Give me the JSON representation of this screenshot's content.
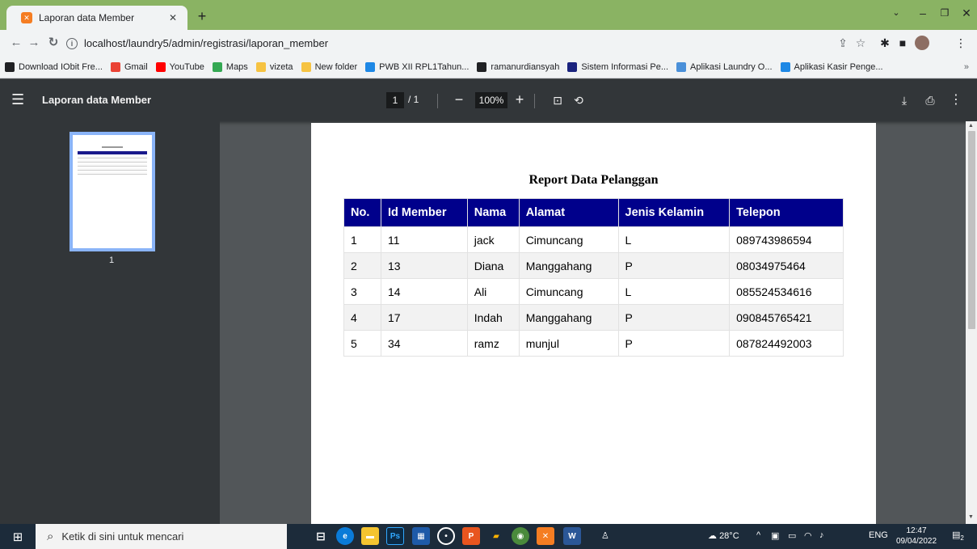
{
  "browser": {
    "tab_title": "Laporan data Member",
    "tab_favicon": "XAMPP",
    "url": "localhost/laundry5/admin/registrasi/laporan_member",
    "bookmarks": [
      {
        "label": "Download IObit Fre...",
        "icon": "download-icon",
        "color": "#202124"
      },
      {
        "label": "Gmail",
        "icon": "gmail-icon",
        "color": "#ea4335"
      },
      {
        "label": "YouTube",
        "icon": "youtube-icon",
        "color": "#ff0000"
      },
      {
        "label": "Maps",
        "icon": "maps-icon",
        "color": "#34a853"
      },
      {
        "label": "vizeta",
        "icon": "folder-icon",
        "color": "#f6c342"
      },
      {
        "label": "New folder",
        "icon": "folder-icon",
        "color": "#f6c342"
      },
      {
        "label": "PWB XII RPL1Tahun...",
        "icon": "classroom-icon",
        "color": "#1e88e5"
      },
      {
        "label": "ramanurdiansyah",
        "icon": "github-icon",
        "color": "#202124"
      },
      {
        "label": "Sistem Informasi Pe...",
        "icon": "d-app-icon",
        "color": "#1a237e"
      },
      {
        "label": "Aplikasi Laundry O...",
        "icon": "laundry-app-icon",
        "color": "#4a90d9"
      },
      {
        "label": "Aplikasi Kasir Penge...",
        "icon": "kasir-app-icon",
        "color": "#1e88e5"
      }
    ],
    "bookmarks_more": "»"
  },
  "pdf_viewer": {
    "title": "Laporan data Member",
    "current_page": "1",
    "total_pages": "/ 1",
    "zoom": "100%",
    "thumbnail_label": "1"
  },
  "report": {
    "title": "Report Data Pelanggan",
    "columns": [
      "No.",
      "Id Member",
      "Nama",
      "Alamat",
      "Jenis Kelamin",
      "Telepon"
    ],
    "rows": [
      [
        "1",
        "11",
        "jack",
        "Cimuncang",
        "L",
        "089743986594"
      ],
      [
        "2",
        "13",
        "Diana",
        "Manggahang",
        "P",
        "08034975464"
      ],
      [
        "3",
        "14",
        "Ali",
        "Cimuncang",
        "L",
        "085524534616"
      ],
      [
        "4",
        "17",
        "Indah",
        "Manggahang",
        "P",
        "090845765421"
      ],
      [
        "5",
        "34",
        "ramz",
        "munjul",
        "P",
        "087824492003"
      ]
    ]
  },
  "taskbar": {
    "search_placeholder": "Ketik di sini untuk mencari",
    "weather": "28°C",
    "language": "ENG",
    "time": "12:47",
    "date": "09/04/2022",
    "notification_count": "2"
  }
}
